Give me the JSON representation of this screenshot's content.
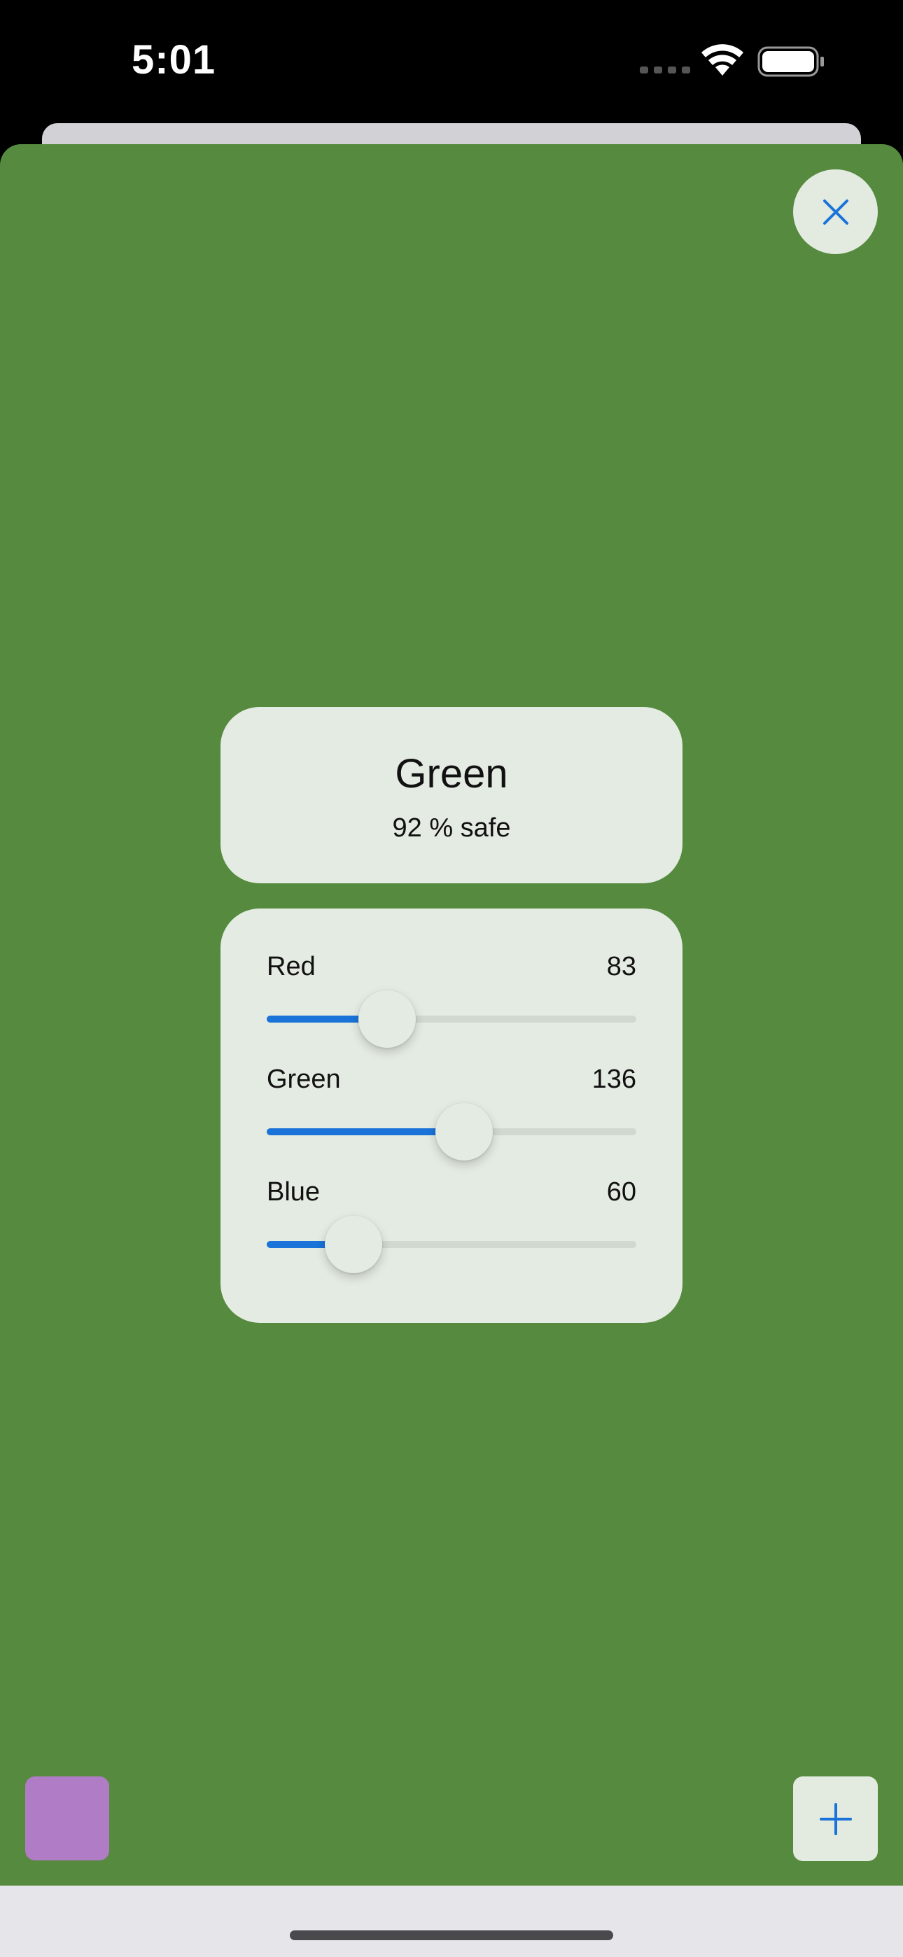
{
  "status_bar": {
    "time": "5:01",
    "icons": [
      "signal-icon",
      "wifi-icon",
      "battery-icon"
    ]
  },
  "header": {
    "close_icon": "close-icon"
  },
  "color_card": {
    "name": "Green",
    "safety": "92 % safe"
  },
  "sliders": [
    {
      "label": "Red",
      "value": "83",
      "fraction": 0.3255
    },
    {
      "label": "Green",
      "value": "136",
      "fraction": 0.5333
    },
    {
      "label": "Blue",
      "value": "60",
      "fraction": 0.2353
    }
  ],
  "footer": {
    "swatch_color": "#b07cc6",
    "add_icon": "plus-icon"
  },
  "colors": {
    "background": "#568a3e",
    "card": "#e4ebe2",
    "accent": "#1a73d9"
  }
}
